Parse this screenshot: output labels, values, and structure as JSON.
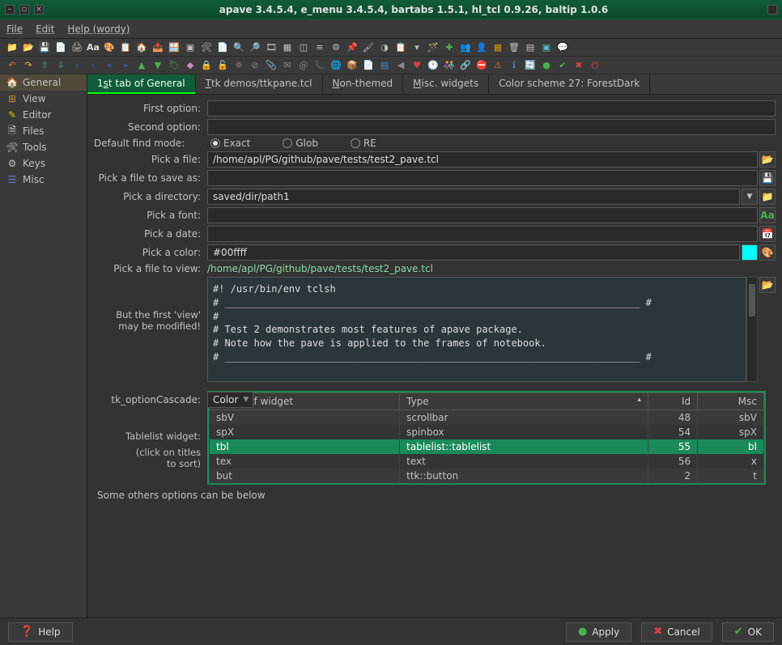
{
  "window": {
    "title": "apave 3.4.5.4,  e_menu 3.4.5.4,  bartabs 1.5.1,  hl_tcl 0.9.26,  baltip 1.0.6"
  },
  "menubar": {
    "file": "File",
    "edit": "Edit",
    "help": "Help (wordy)"
  },
  "sidebar": {
    "items": [
      {
        "label": "General",
        "icon": "🏠"
      },
      {
        "label": "View",
        "icon": "⊞"
      },
      {
        "label": "Editor",
        "icon": "✎"
      },
      {
        "label": "Files",
        "icon": "🗎"
      },
      {
        "label": "Tools",
        "icon": "🛠"
      },
      {
        "label": "Keys",
        "icon": "⚙"
      },
      {
        "label": "Misc",
        "icon": "☰"
      }
    ]
  },
  "tabs": [
    {
      "label_plain": "1st tab of General",
      "u": "0"
    },
    {
      "label_plain": "Ttk demos/ttkpane.tcl",
      "u": "0"
    },
    {
      "label_plain": "Non-themed",
      "u": "0"
    },
    {
      "label_plain": "Misc. widgets",
      "u": "0"
    },
    {
      "label_plain": "Color scheme 27: ForestDark",
      "u": ""
    }
  ],
  "form": {
    "first_option_label": "First option:",
    "first_option_value": "",
    "second_option_label": "Second option:",
    "second_option_value": "",
    "find_mode_label": "Default find mode:",
    "find_opts": {
      "exact": "Exact",
      "glob": "Glob",
      "re": "RE"
    },
    "find_selected": "exact",
    "pick_file_label": "Pick a file:",
    "pick_file_value": "/home/apl/PG/github/pave/tests/test2_pave.tcl",
    "save_as_label": "Pick a file to save as:",
    "save_as_value": "",
    "dir_label": "Pick a directory:",
    "dir_value": "saved/dir/path1",
    "font_label": "Pick a font:",
    "font_value": "",
    "date_label": "Pick a date:",
    "date_value": "",
    "color_label": "Pick a color:",
    "color_value": "#00ffff",
    "view_label": "Pick a file to view:",
    "view_value": "/home/apl/PG/github/pave/tests/test2_pave.tcl",
    "modify_note1": "But the first 'view'",
    "modify_note2": "may be modified!",
    "textarea": "#! /usr/bin/env tclsh\n# _______________________________________________________________________ #\n#\n# Test 2 demonstrates most features of apave package.\n# Note how the pave is applied to the frames of notebook.\n# _______________________________________________________________________ #\n",
    "cascade_label": "tk_optionCascade:",
    "cascade_value": "Color",
    "table_label": "Tablelist widget:",
    "table_note1": "(click on titles",
    "table_note2": "to sort)",
    "others_note": "Some others options can be below"
  },
  "table": {
    "headers": {
      "name": "Name of widget",
      "type": "Type",
      "id": "Id",
      "msc": "Msc"
    },
    "rows": [
      {
        "name": "sbV",
        "type": "scrollbar",
        "id": "48",
        "msc": "sbV"
      },
      {
        "name": "spX",
        "type": "spinbox",
        "id": "54",
        "msc": "spX"
      },
      {
        "name": "tbl",
        "type": "tablelist::tablelist",
        "id": "55",
        "msc": "bl"
      },
      {
        "name": "tex",
        "type": "text",
        "id": "56",
        "msc": "x"
      },
      {
        "name": "but",
        "type": "ttk::button",
        "id": "2",
        "msc": "t"
      }
    ],
    "selected_index": 2
  },
  "buttons": {
    "help": "Help",
    "apply": "Apply",
    "cancel": "Cancel",
    "ok": "OK"
  }
}
